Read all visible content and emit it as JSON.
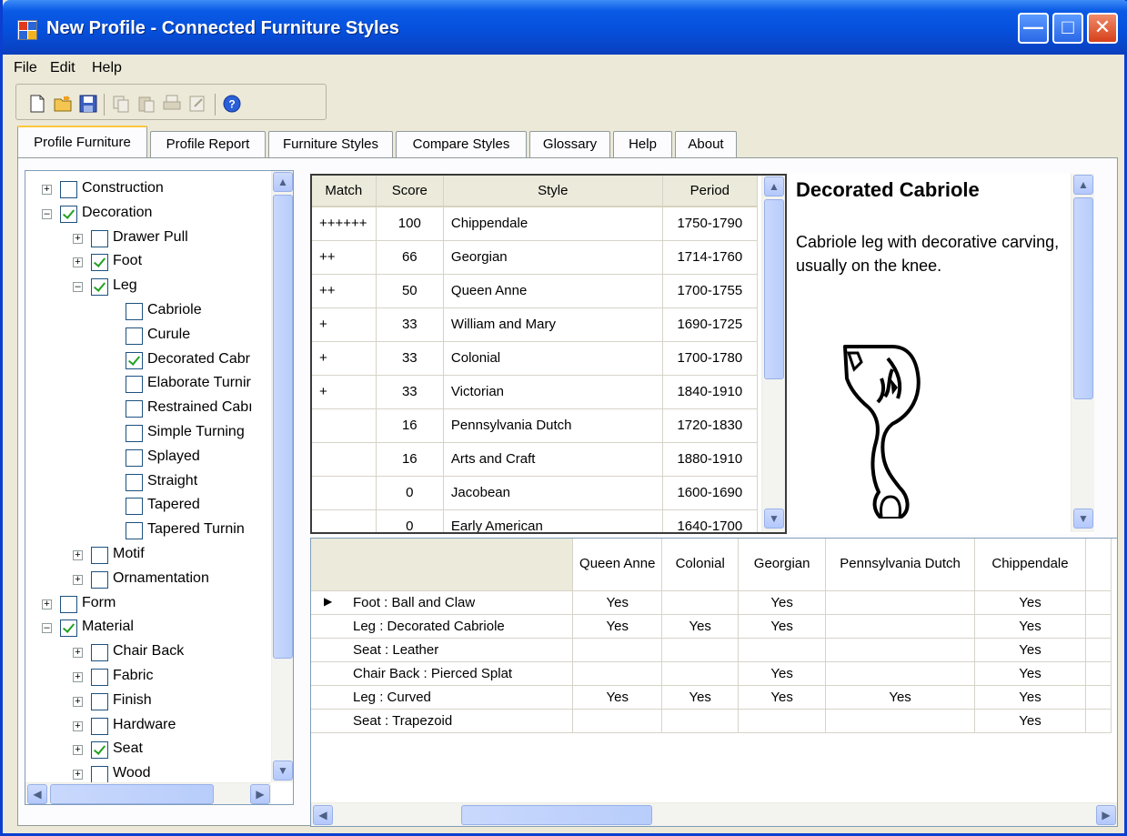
{
  "window": {
    "title": "New Profile - Connected Furniture Styles",
    "controls": [
      "minimize",
      "maximize",
      "close"
    ]
  },
  "menu": [
    "File",
    "Edit",
    "Help"
  ],
  "toolbar": [
    "new-file-icon",
    "open-folder-icon",
    "save-icon",
    "copy-icon",
    "paste-icon",
    "print-icon",
    "properties-icon",
    "help-icon"
  ],
  "tabs": [
    "Profile Furniture",
    "Profile Report",
    "Furniture Styles",
    "Compare Styles",
    "Glossary",
    "Help",
    "About"
  ],
  "tree": [
    {
      "label": "Construction",
      "checked": false,
      "expander": "+",
      "level": 0
    },
    {
      "label": "Decoration",
      "checked": true,
      "expander": "-",
      "level": 0
    },
    {
      "label": "Drawer Pull",
      "checked": false,
      "expander": "+",
      "level": 1
    },
    {
      "label": "Foot",
      "checked": true,
      "expander": "+",
      "level": 1
    },
    {
      "label": "Leg",
      "checked": true,
      "expander": "-",
      "level": 1
    },
    {
      "label": "Cabriole",
      "checked": false,
      "expander": "",
      "level": 2
    },
    {
      "label": "Curule",
      "checked": false,
      "expander": "",
      "level": 2
    },
    {
      "label": "Decorated Cabr",
      "checked": true,
      "expander": "",
      "level": 2
    },
    {
      "label": "Elaborate Turnir",
      "checked": false,
      "expander": "",
      "level": 2
    },
    {
      "label": "Restrained Cabı",
      "checked": false,
      "expander": "",
      "level": 2
    },
    {
      "label": "Simple Turning",
      "checked": false,
      "expander": "",
      "level": 2
    },
    {
      "label": "Splayed",
      "checked": false,
      "expander": "",
      "level": 2
    },
    {
      "label": "Straight",
      "checked": false,
      "expander": "",
      "level": 2
    },
    {
      "label": "Tapered",
      "checked": false,
      "expander": "",
      "level": 2
    },
    {
      "label": "Tapered Turnin",
      "checked": false,
      "expander": "",
      "level": 2
    },
    {
      "label": "Motif",
      "checked": false,
      "expander": "+",
      "level": 1
    },
    {
      "label": "Ornamentation",
      "checked": false,
      "expander": "+",
      "level": 1
    },
    {
      "label": "Form",
      "checked": false,
      "expander": "+",
      "level": 0
    },
    {
      "label": "Material",
      "checked": true,
      "expander": "-",
      "level": 0
    },
    {
      "label": "Chair Back",
      "checked": false,
      "expander": "+",
      "level": 1
    },
    {
      "label": "Fabric",
      "checked": false,
      "expander": "+",
      "level": 1
    },
    {
      "label": "Finish",
      "checked": false,
      "expander": "+",
      "level": 1
    },
    {
      "label": "Hardware",
      "checked": false,
      "expander": "+",
      "level": 1
    },
    {
      "label": "Seat",
      "checked": true,
      "expander": "+",
      "level": 1
    },
    {
      "label": "Wood",
      "checked": false,
      "expander": "+",
      "level": 1
    }
  ],
  "match_grid": {
    "columns": [
      "Match",
      "Score",
      "Style",
      "Period"
    ],
    "rows": [
      [
        "++++++",
        "100",
        "Chippendale",
        "1750-1790"
      ],
      [
        "++",
        "66",
        "Georgian",
        "1714-1760"
      ],
      [
        "++",
        "50",
        "Queen Anne",
        "1700-1755"
      ],
      [
        "+",
        "33",
        "William and Mary",
        "1690-1725"
      ],
      [
        "+",
        "33",
        "Colonial",
        "1700-1780"
      ],
      [
        "+",
        "33",
        "Victorian",
        "1840-1910"
      ],
      [
        "",
        "16",
        "Pennsylvania Dutch",
        "1720-1830"
      ],
      [
        "",
        "16",
        "Arts and Craft",
        "1880-1910"
      ],
      [
        "",
        "0",
        "Jacobean",
        "1600-1690"
      ],
      [
        "",
        "0",
        "Early American",
        "1640-1700"
      ]
    ]
  },
  "description": {
    "title": "Decorated Cabriole",
    "text": "Cabriole leg with decorative carving, usually on the knee."
  },
  "compare_grid": {
    "columns": [
      "Queen Anne",
      "Colonial",
      "Georgian",
      "Pennsylvania Dutch",
      "Chippendale"
    ],
    "rows": [
      {
        "label": "Foot : Ball and Claw",
        "values": [
          "Yes",
          "",
          "Yes",
          "",
          "Yes"
        ],
        "current": true
      },
      {
        "label": "Leg : Decorated Cabriole",
        "values": [
          "Yes",
          "Yes",
          "Yes",
          "",
          "Yes"
        ],
        "current": false
      },
      {
        "label": "Seat : Leather",
        "values": [
          "",
          "",
          "",
          "",
          "Yes"
        ],
        "current": false
      },
      {
        "label": "Chair Back : Pierced Splat",
        "values": [
          "",
          "",
          "Yes",
          "",
          "Yes"
        ],
        "current": false
      },
      {
        "label": "Leg : Curved",
        "values": [
          "Yes",
          "Yes",
          "Yes",
          "Yes",
          "Yes"
        ],
        "current": false
      },
      {
        "label": "Seat : Trapezoid",
        "values": [
          "",
          "",
          "",
          "",
          "Yes"
        ],
        "current": false
      }
    ]
  }
}
